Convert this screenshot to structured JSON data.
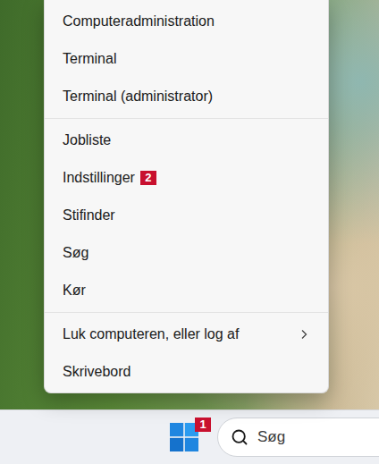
{
  "menu": {
    "groups": [
      [
        {
          "label": "Computeradministration",
          "submenu": false,
          "badge": null
        },
        {
          "label": "Terminal",
          "submenu": false,
          "badge": null
        },
        {
          "label": "Terminal (administrator)",
          "submenu": false,
          "badge": null
        }
      ],
      [
        {
          "label": "Jobliste",
          "submenu": false,
          "badge": null
        },
        {
          "label": "Indstillinger",
          "submenu": false,
          "badge": "2"
        },
        {
          "label": "Stifinder",
          "submenu": false,
          "badge": null
        },
        {
          "label": "Søg",
          "submenu": false,
          "badge": null
        },
        {
          "label": "Kør",
          "submenu": false,
          "badge": null
        }
      ],
      [
        {
          "label": "Luk computeren, eller log af",
          "submenu": true,
          "badge": null
        },
        {
          "label": "Skrivebord",
          "submenu": false,
          "badge": null
        }
      ]
    ]
  },
  "taskbar": {
    "start_badge": "1",
    "search": {
      "placeholder": "Søg"
    }
  }
}
